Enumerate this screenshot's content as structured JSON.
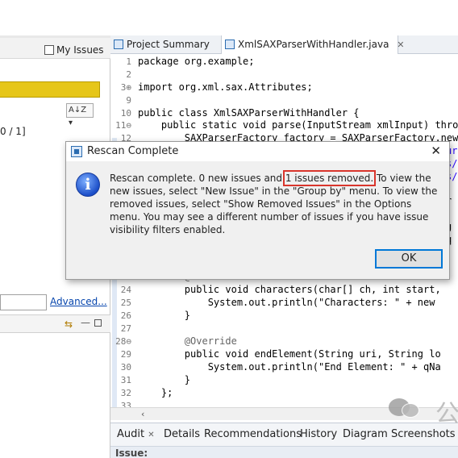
{
  "left_panel": {
    "my_issues_label": "My Issues",
    "sort_icon": "A↓Z",
    "counter_text": "0 / 1]",
    "advanced_link": "Advanced...",
    "icons": {
      "link": "link-icon",
      "minimize": "minimize-icon",
      "maximize": "maximize-icon"
    }
  },
  "editor": {
    "tabs": [
      {
        "label": "Project Summary",
        "close": ""
      },
      {
        "label": "XmlSAXParserWithHandler.java",
        "close": "✕"
      }
    ],
    "lines": [
      {
        "no": "1",
        "code": "package org.example;"
      },
      {
        "no": "2",
        "code": ""
      },
      {
        "no": "3⊕",
        "code": "import org.xml.sax.Attributes;"
      },
      {
        "no": "9",
        "code": ""
      },
      {
        "no": "10",
        "code": "public class XmlSAXParserWithHandler {"
      },
      {
        "no": "11⊖",
        "code": "    public static void parse(InputStream xmlInput) throw"
      },
      {
        "no": "12",
        "code": "        SAXParserFactory factory = SAXParserFactory.newI"
      },
      {
        "no": "23⊖",
        "code": "        @Override"
      },
      {
        "no": "24",
        "code": "        public void characters(char[] ch, int start,"
      },
      {
        "no": "25",
        "code": "            System.out.println(\"Characters: \" + new"
      },
      {
        "no": "26",
        "code": "        }"
      },
      {
        "no": "27",
        "code": ""
      },
      {
        "no": "28⊖",
        "code": "        @Override"
      },
      {
        "no": "29",
        "code": "        public void endElement(String uri, String lo"
      },
      {
        "no": "30",
        "code": "            System.out.println(\"End Element: \" + qNa"
      },
      {
        "no": "31",
        "code": "        }"
      },
      {
        "no": "32",
        "code": "    };"
      },
      {
        "no": "33",
        "code": ""
      }
    ],
    "right_edge_fragments": [
      "ur",
      "s/",
      "s/",
      "r",
      "g",
      "q"
    ]
  },
  "bottom_tabs": {
    "audit": "Audit",
    "audit_close": "✕",
    "details": "Details",
    "recommendations": "Recommendations",
    "history": "History",
    "diagram": "Diagram",
    "screenshots": "Screenshots",
    "issue_label": "Issue:"
  },
  "dialog": {
    "title": "Rescan Complete",
    "close": "✕",
    "icon_glyph": "i",
    "msg_before": "Rescan complete. 0 new issues and ",
    "msg_highlight": "1 issues removed.",
    "msg_after": " To view the new issues, select \"New Issue\" in the \"Group by\" menu. To view the removed issues, select \"Show Removed Issues\" in the Options menu. You may see a different number of issues if you have issue visibility filters enabled.",
    "ok": "OK"
  },
  "watermark": {
    "char": "公"
  },
  "colors": {
    "highlight_box": "#d9352c",
    "yellow_bar": "#e6c619",
    "keyword": "#7f0055",
    "string": "#2a00ff",
    "link": "#0645ad",
    "ok_border": "#0078d7"
  }
}
